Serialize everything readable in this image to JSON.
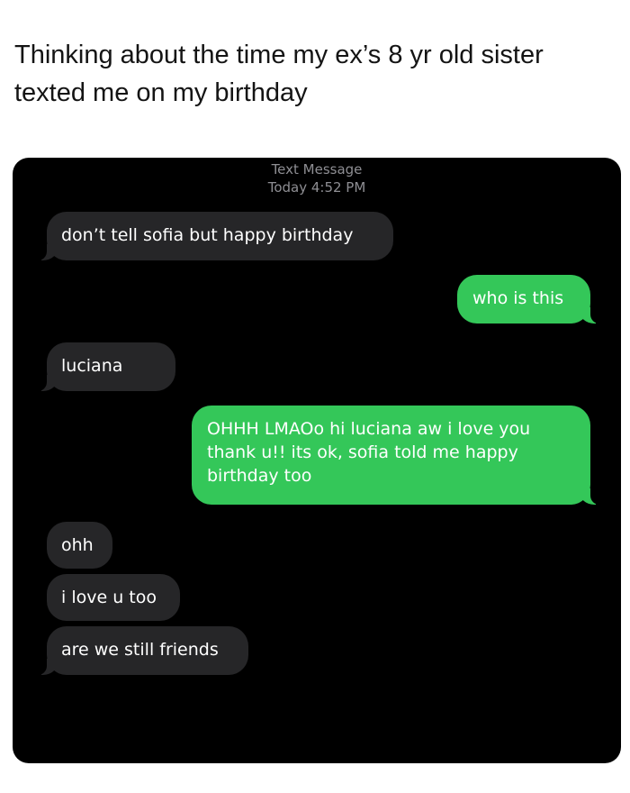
{
  "post": {
    "caption": "Thinking about the time my ex’s 8 yr old sister texted me on my birthday"
  },
  "conversation": {
    "header": {
      "kind": "Text Message",
      "timestamp": "Today 4:52 PM"
    },
    "messages": [
      {
        "direction": "incoming",
        "text": "don’t tell sofia but happy birthday"
      },
      {
        "direction": "outgoing",
        "text": "who is this"
      },
      {
        "direction": "incoming",
        "text": "luciana"
      },
      {
        "direction": "outgoing",
        "text": "OHHH LMAOo hi luciana aw i love you thank u!! its ok, sofia told me happy birthday too"
      },
      {
        "direction": "incoming",
        "text": "ohh"
      },
      {
        "direction": "incoming",
        "text": "i love u too"
      },
      {
        "direction": "incoming",
        "text": "are we still friends"
      }
    ]
  },
  "colors": {
    "incoming_bubble": "#262628",
    "outgoing_bubble": "#34c759",
    "screen_background": "#000000"
  }
}
